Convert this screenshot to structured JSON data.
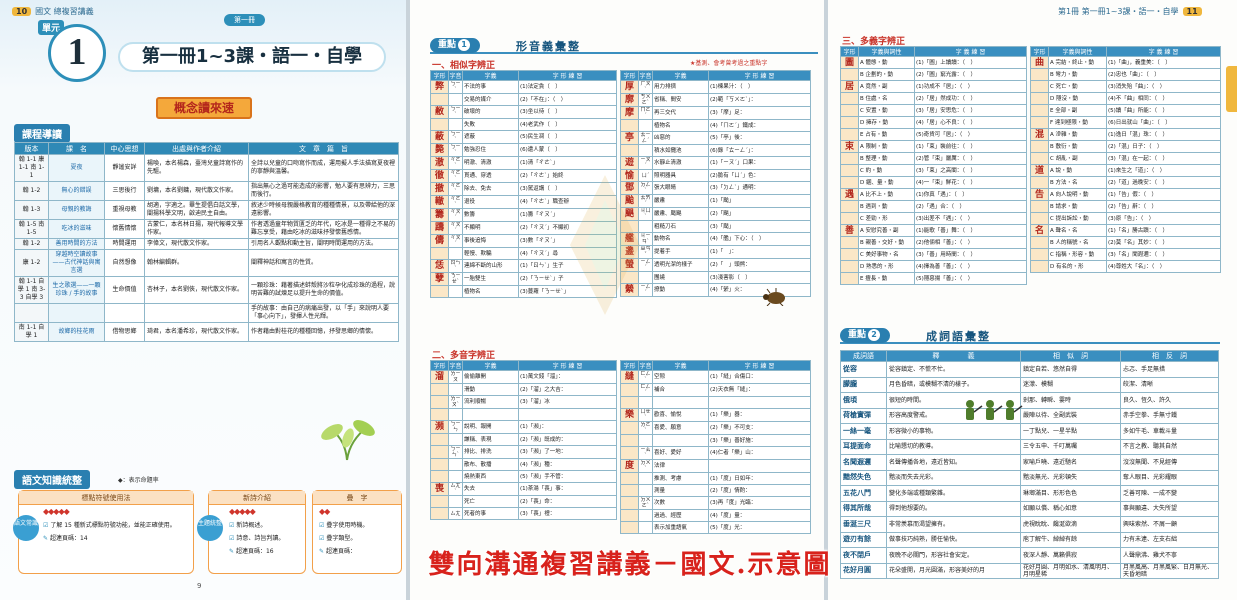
{
  "left": {
    "unit_tag": "單元",
    "unit_number": "1",
    "book_tag": "第一冊",
    "title": "第一冊1~3課・語一・自學",
    "concept_banner": "概念讀來速",
    "course_heading": "課程導讀",
    "course_columns": [
      "版本",
      "課　名",
      "中心思想",
      "出處與作者介紹",
      "文　章　篇　旨"
    ],
    "course_rows": [
      {
        "ver": "翰 1-1 康 1-1 南 1-1",
        "lesson": "夏夜",
        "idea": "靜謐安詳",
        "source": "楊喚，本名楊森，臺灣兒童詩寫作的先驅。",
        "gist": "全詩以兒童的口吻寫作而成，運用擬人手法描寫夏夜裡的寧靜與溫馨。"
      },
      {
        "ver": "翰 1-2",
        "lesson": "無心的錯誤",
        "idea": "三思後行",
        "source": "劉墉，本名劉鏞，現代散文作家。",
        "gist": "指出無心之過可能造成的影響，勉人要有思辨力，三思而後行。"
      },
      {
        "ver": "翰 1-3",
        "lesson": "母親的教誨",
        "idea": "重視母教",
        "source": "胡適，字適之。畢生提倡白話文學，闡揚科學文明，啟迪民主自由。",
        "gist": "敘述少時候母親嚴格教育的種種情景，以及帶給他的深遠影響。"
      },
      {
        "ver": "翰 1-5 南 1-5",
        "lesson": "吃冰的滋味",
        "idea": "懷舊情懷",
        "source": "古蒙仁，本名林日揚，現代報導文學作家。",
        "gist": "作者透過童年物質匱乏的年代，吃冰是一種得之不易的難忘享受，藉由吃冰的滋味抒發懷舊感情。"
      },
      {
        "ver": "翰 1-2",
        "lesson": "善用時間的方法",
        "idea": "時間運用",
        "source": "李偉文，現代散文作家。",
        "gist": "引用名人觀點和動主旨，闡明時間運用的方法。"
      },
      {
        "ver": "康 1-2",
        "lesson": "穿越時空讀故事——古代神話與寓言選",
        "idea": "自然想像",
        "source": "翰林編輯群。",
        "gist": "闡釋神話和寓言的性質。"
      },
      {
        "ver": "翰 1-1 自學 1 南 3-3 自學 3",
        "lesson": "生之歌選——一顆珍珠 / 手的故事",
        "idea": "生命價值",
        "source": "杏林子，本名劉俠，現代散文作家。",
        "gist": "一顆珍珠：藉著描述蚌殼將沙粒孕化成珍珠的過程，說明苦難的試煉足以提升生命的價值。"
      },
      {
        "ver": "",
        "lesson": "",
        "idea": "",
        "source": "",
        "gist": "手的故事：由自己的病痛出發，以「手」來說明人要「事心向下」，發揮人性光輝。"
      },
      {
        "ver": "南 1-1 自學 1",
        "lesson": "故鄉的桂花雨",
        "idea": "借物思鄉",
        "source": "琦君，本名潘希珍，現代散文作家。",
        "gist": "作者藉由對桂花的種種回憶，抒發思鄉的情懷。"
      }
    ],
    "grammar_heading": "語文知識統整",
    "star_note": "◆：表示命題率",
    "grammar_boxes": [
      {
        "side": "語文常識",
        "title": "標點符號使用法",
        "rate": "◆◆◆◆◆",
        "line1": "了解 15 種新式標點符號功能，並能正確使用。",
        "pages": "超連頁碼：14"
      },
      {
        "side": "主題統整",
        "title": "新詩介紹",
        "rate": "◆◆◆◆◆",
        "line1": "新詩概述。",
        "line2": "詩意、詩旨判讀。",
        "pages": "超連頁碼：16"
      },
      {
        "title": "疊　字",
        "rate": "◆◆",
        "line1": "疊字使用時機。",
        "line2": "疊字類型。",
        "pages": "超連頁碼："
      }
    ],
    "page_number": "9"
  },
  "mid": {
    "page_number": "10",
    "header": "國文 總複習講義",
    "focus_label": "重點",
    "focus_num": "1",
    "focus_title": "形音義彙整",
    "similar_heading": "一、相似字辨正",
    "legend": "★基測、會考曾考過之重點字",
    "table_columns": [
      "字形",
      "字音",
      "字義",
      "字 形 練 習"
    ],
    "similar_left": [
      {
        "char": "弊",
        "read": "ㄅㄧˋ",
        "meaning": "不法的事",
        "practice": "(1)法定貪（　）"
      },
      {
        "char": "",
        "read": "",
        "meaning": "交易的媒介",
        "practice": "(2)「不在」：（　）"
      },
      {
        "char": "敝",
        "read": "ㄅㄧˋ",
        "meaning": "破壞的",
        "practice": "(3)坐以待（　）"
      },
      {
        "char": "",
        "read": "",
        "meaning": "失敗",
        "practice": "(4)老武作（　）"
      },
      {
        "char": "蔽",
        "read": "ㄅㄧˋ",
        "meaning": "遮蔽",
        "practice": "(5)民生凋（　）"
      },
      {
        "char": "斃",
        "read": "ㄅㄧˋ",
        "meaning": "勉強忍住",
        "practice": "(6)遭人蒙（　）"
      },
      {
        "char": "澈",
        "read": "ㄔㄜˋ",
        "meaning": "明澈、清澈",
        "practice": "(1)清「ㄔㄜˋ」"
      },
      {
        "char": "徹",
        "read": "ㄔㄜˋ",
        "meaning": "貫通、穿透",
        "practice": "(2)「ㄔㄜˋ」始終"
      },
      {
        "char": "撤",
        "read": "ㄔㄜˋ",
        "meaning": "除去、免去",
        "practice": "(3)駕返講（　）"
      },
      {
        "char": "轍",
        "read": "ㄔㄜˋ",
        "meaning": "退役",
        "practice": "(4)「ㄔㄜˋ」職查辦"
      },
      {
        "char": "籌",
        "read": "ㄔㄡˊ",
        "meaning": "數籌",
        "practice": "(1)籌「ㄔㄡˊ」"
      },
      {
        "char": "躊",
        "read": "ㄔㄡˊ",
        "meaning": "不顯明",
        "practice": "(2)「ㄔㄡˊ」不顯初"
      },
      {
        "char": "儔",
        "read": "ㄔㄡˊ",
        "meaning": "事後追悔",
        "practice": "(3)數「ㄔㄡˊ」"
      },
      {
        "char": "",
        "read": "",
        "meaning": "輕慢、欺騙",
        "practice": "(4)「ㄔㄡˊ」尋"
      },
      {
        "char": "恁",
        "read": "ㄖㄣˋ",
        "meaning": "連綿不斷的山形",
        "practice": "(1)「ㄖㄣˋ」生子"
      },
      {
        "char": "孽",
        "read": "ㄋㄧㄝˋ",
        "meaning": "一胎雙生",
        "practice": "(2)「ㄋㄧㄝˋ」子"
      },
      {
        "char": "",
        "read": "",
        "meaning": "植物名",
        "practice": "(3)蔓蘿「ㄋㄧㄝˋ」"
      }
    ],
    "similar_right": [
      {
        "char": "厚",
        "read": "ㄏㄡˋ",
        "meaning": "用力排擠",
        "practice": "(1)楝果汁：（　）"
      },
      {
        "char": "廓",
        "read": "ㄎㄨㄛˋ",
        "meaning": "省稱、間安",
        "practice": "(2)範「ㄎㄨㄛˋ」："
      },
      {
        "char": "摩",
        "read": "ㄇㄛˊ",
        "meaning": "再三交代",
        "practice": "(3)「摩」足："
      },
      {
        "char": "",
        "read": "",
        "meaning": "植物名",
        "practice": "(4)「ㄇㄛˊ」鐵成："
      },
      {
        "char": "亭",
        "read": "ㄊㄧㄥˊ",
        "meaning": "凶惡的",
        "practice": "(5)「亭」後："
      },
      {
        "char": "",
        "read": "",
        "meaning": "積水如攤池",
        "practice": "(6)錄「ㄊㄧㄥˊ」："
      },
      {
        "char": "遊",
        "read": "ㄧㄡˊ",
        "meaning": "水靜止清澈",
        "practice": "(1)「ㄧㄡˊ」口果："
      },
      {
        "char": "愉",
        "read": "ㄩˊ",
        "meaning": "照明器具",
        "practice": "(2)臉有「ㄩˊ」色："
      },
      {
        "char": "鄧",
        "read": "ㄉㄥˋ",
        "meaning": "張大眼睛",
        "practice": "(3)「ㄉㄥˋ」通明："
      },
      {
        "char": "颱",
        "read": "ㄊㄞˊ",
        "meaning": "嚴肅",
        "practice": "(1)「颱」"
      },
      {
        "char": "颶",
        "read": "ㄐㄩˋ",
        "meaning": "嚴肅、颳颶",
        "practice": "(2)「颶」"
      },
      {
        "char": "",
        "read": "",
        "meaning": "粗糙刀石",
        "practice": "(3)「颳」"
      },
      {
        "char": "艦",
        "read": "ㄐㄧㄢˋ",
        "meaning": "動物名",
        "practice": "(4)「艦」下心：（　）"
      },
      {
        "char": "盞",
        "read": "ㄓㄢˇ",
        "meaning": "提着手",
        "practice": "(1)「　」："
      },
      {
        "char": "螢",
        "read": "ㄧㄥˊ",
        "meaning": "透明光潔的樣子",
        "practice": "(2)「　」頭熊："
      },
      {
        "char": "",
        "read": "",
        "meaning": "團繞",
        "practice": "(3)淺害影（　）"
      },
      {
        "char": "縈",
        "read": "ㄧㄥˊ",
        "meaning": "撩動",
        "practice": "(4)「縈」火："
      }
    ],
    "polyphone_heading": "二、多音字辨正",
    "poly_left": [
      {
        "char": "溜",
        "read": "ㄌㄧㄡ",
        "meaning": "偷偷離開",
        "practice": "(1)萬文錢「溜」："
      },
      {
        "char": "",
        "read": "",
        "meaning": "滑動",
        "practice": "(2)「溜」之大吉："
      },
      {
        "char": "",
        "read": "ㄌㄧㄡˋ",
        "meaning": "流利順暢",
        "practice": "(3)「溜」冰"
      },
      {
        "char": "",
        "read": "",
        "meaning": "",
        "practice": ""
      },
      {
        "char": "瀕",
        "read": "ㄅㄧㄣ",
        "meaning": "說明、報開",
        "practice": "(1)「瀕」："
      },
      {
        "char": "",
        "read": "",
        "meaning": "謙稱、表現",
        "practice": "(2)「瀕」既成的："
      },
      {
        "char": "",
        "read": "ㄅㄧㄣˋ",
        "meaning": "排比、排洗",
        "practice": "(3)「瀕」了一地："
      },
      {
        "char": "",
        "read": "",
        "meaning": "散布、散播",
        "practice": "(4)「瀕」種："
      },
      {
        "char": "",
        "read": "",
        "meaning": "燒熱東西",
        "practice": "(5)「瀕」手不管："
      },
      {
        "char": "喪",
        "read": "ㄙㄤˋ",
        "meaning": "失去",
        "practice": "(1)茶湯「喪」事："
      },
      {
        "char": "",
        "read": "",
        "meaning": "死亡",
        "practice": "(2)「喪」命："
      },
      {
        "char": "",
        "read": "ㄙㄤ",
        "meaning": "死者的事",
        "practice": "(3)「喪」禮："
      }
    ],
    "poly_right": [
      {
        "char": "縫",
        "read": "ㄈㄥˋ",
        "meaning": "空隙",
        "practice": "(1)「縫」合傷口："
      },
      {
        "char": "",
        "read": "ㄈㄥˊ",
        "meaning": "補合",
        "practice": "(2)天衣無「縫」："
      },
      {
        "char": "",
        "read": "",
        "meaning": "",
        "practice": ""
      },
      {
        "char": "樂",
        "read": "ㄩㄝˋ",
        "meaning": "歡喜、愉悅",
        "practice": "(1)「樂」器："
      },
      {
        "char": "",
        "read": "ㄌㄜˋ",
        "meaning": "喜愛、願意",
        "practice": "(2)「樂」不可支："
      },
      {
        "char": "",
        "read": "",
        "meaning": "",
        "practice": "(3)「樂」善好施："
      },
      {
        "char": "",
        "read": "ㄧㄠˋ",
        "meaning": "喜好、愛好",
        "practice": "(4)仁者「樂」山："
      },
      {
        "char": "度",
        "read": "ㄉㄨˋ",
        "meaning": "法律",
        "practice": ""
      },
      {
        "char": "",
        "read": "",
        "meaning": "推測、考慮",
        "practice": "(1)「度」日如年："
      },
      {
        "char": "",
        "read": "",
        "meaning": "測量",
        "practice": "(2)「度」情酌："
      },
      {
        "char": "",
        "read": "ㄉㄨㄛˋ",
        "meaning": "次數",
        "practice": "(3)再「度」光臨："
      },
      {
        "char": "",
        "read": "",
        "meaning": "過過、經歷",
        "practice": "(4)「度」量："
      },
      {
        "char": "",
        "read": "",
        "meaning": "表示加重語氣",
        "practice": "(5)「度」光："
      }
    ]
  },
  "right": {
    "header_unit": "第1冊",
    "header_title": "第一冊1~3課・語一・自學",
    "page_number": "11",
    "multi_heading": "三、多義字辨正",
    "multi_columns": [
      "字形",
      "字義與詞性",
      "字 義 練 習"
    ],
    "multi_left": [
      {
        "char": "圖",
        "meaning": "A 體態・動",
        "practice": "(1)「圖」上讀讀：（　）"
      },
      {
        "char": "",
        "meaning": "B 企劃的・動",
        "practice": "(2)「圖」窮光露：（　）"
      },
      {
        "char": "居",
        "meaning": "A 竟然・副",
        "practice": "(1)功成不「居」：（　）"
      },
      {
        "char": "",
        "meaning": "B 住處・名",
        "practice": "(2)「居」然成功：（　）"
      },
      {
        "char": "",
        "meaning": "C 安置・動",
        "practice": "(3)「居」安思危：（　）"
      },
      {
        "char": "",
        "meaning": "D 擁存・動",
        "practice": "(4)「居」心不良：（　）"
      },
      {
        "char": "",
        "meaning": "E 占有・動",
        "practice": "(5)奇貨可「居」：（　）"
      },
      {
        "char": "束",
        "meaning": "A 限制・動",
        "practice": "(1)「束」裝前往：（　）"
      },
      {
        "char": "",
        "meaning": "B 整理・動",
        "practice": "(2)管「束」嚴厲：（　）"
      },
      {
        "char": "",
        "meaning": "C 約・動",
        "practice": "(3)「束」之高閣：（　）"
      },
      {
        "char": "",
        "meaning": "D 綑、量・動",
        "practice": "(4)一「束」鮮花：（　）"
      },
      {
        "char": "遇",
        "meaning": "A 比不上・動",
        "practice": "(1)你真「遇」：（　）"
      },
      {
        "char": "",
        "meaning": "B 遇到・動",
        "practice": "(2)「遇」合：（　）"
      },
      {
        "char": "",
        "meaning": "C 差勁・形",
        "practice": "(3)出差不「遇」：（　）"
      },
      {
        "char": "善",
        "meaning": "A 安慰究善・副",
        "practice": "(1)能歌「善」舞：（　）"
      },
      {
        "char": "",
        "meaning": "B 親善・交好・動",
        "practice": "(2)他倆相「善」：（　）"
      },
      {
        "char": "",
        "meaning": "C 美好事物・名",
        "practice": "(3)「善」用時間：（　）"
      },
      {
        "char": "",
        "meaning": "D 熟悉的・形",
        "practice": "(4)擇為善「善」：（　）"
      },
      {
        "char": "",
        "meaning": "E 擅長・動",
        "practice": "(5)隱惡揚「善」：（　）"
      }
    ],
    "multi_right": [
      {
        "char": "曲",
        "meaning": "A 完結・終止・動",
        "practice": "(1)「曲」，義重美：（　）"
      },
      {
        "char": "",
        "meaning": "B 彎力・動",
        "practice": "(2)忠也「曲」：（　）"
      },
      {
        "char": "",
        "meaning": "C 死亡・動",
        "practice": "(3)消失殆「曲」：（　）"
      },
      {
        "char": "",
        "meaning": "D 隱沒・動",
        "practice": "(4)不「曲」相同：（　）"
      },
      {
        "char": "",
        "meaning": "E 全部・副",
        "practice": "(5)讀「曲」所能：（　）"
      },
      {
        "char": "",
        "meaning": "F 達到極限・動",
        "practice": "(6)日出就山「曲」：（　）"
      },
      {
        "char": "混",
        "meaning": "A 滲雜・動",
        "practice": "(1)逸日「混」珠：（　）"
      },
      {
        "char": "",
        "meaning": "B 敷衍・動",
        "practice": "(2)「混」日子：（　）"
      },
      {
        "char": "",
        "meaning": "C 胡亂・副",
        "practice": "(3)「混」在一起：（　）"
      },
      {
        "char": "道",
        "meaning": "A 說・動",
        "practice": "(1)來生之「道」：（　）"
      },
      {
        "char": "",
        "meaning": "B 方法・名",
        "practice": "(2)「道」過晚安：（　）"
      },
      {
        "char": "告",
        "meaning": "A 向人說明・動",
        "practice": "(1)「告」假：（　）"
      },
      {
        "char": "",
        "meaning": "B 請求・動",
        "practice": "(2)「告」辭：（　）"
      },
      {
        "char": "",
        "meaning": "C 提出訴訟・動",
        "practice": "(3)原「告」：（　）"
      },
      {
        "char": "名",
        "meaning": "A 聲名・名",
        "practice": "(1)「名」勝古蹟：（　）"
      },
      {
        "char": "",
        "meaning": "B 人的稱號・名",
        "practice": "(2)莫「名」其妙：（　）"
      },
      {
        "char": "",
        "meaning": "C 指稱・形容・動",
        "practice": "(3)「名」聞遐邇：（　）"
      },
      {
        "char": "",
        "meaning": "D 有名的・形",
        "practice": "(4)尊姓大「名」：（　）"
      }
    ],
    "focus_label": "重點",
    "focus_num": "2",
    "focus_title": "成詞語彙整",
    "idiom_columns": [
      "成詞語",
      "釋　　　　義",
      "相　似　詞",
      "相　反　詞"
    ],
    "idioms": [
      {
        "word": "從容",
        "meaning": "從容鎮定、不慌不忙。",
        "similar": "鎮定自若、悠然自得",
        "opposite": "忐忑、手足無措"
      },
      {
        "word": "朦朧",
        "meaning": "月色昏暗，或模糊不清的樣子。",
        "similar": "迷濛、模糊",
        "opposite": "皎潔、清晰"
      },
      {
        "word": "俄頃",
        "meaning": "很短的時間。",
        "similar": "剎那、轉瞬、霎時",
        "opposite": "良久、恆久、許久"
      },
      {
        "word": "荷槍實彈",
        "meaning": "形容高度警戒。",
        "similar": "嚴陣以待、全副武裝",
        "opposite": "赤手空拳、手無寸鐵"
      },
      {
        "word": "一絲一毫",
        "meaning": "形容微小的事物。",
        "similar": "一丁點兒、一星半點",
        "opposite": "多如牛毛、車載斗量"
      },
      {
        "word": "耳提面命",
        "meaning": "比喻懇切的教導。",
        "similar": "三令五申、千叮萬囑",
        "opposite": "不言之教、聽其自然"
      },
      {
        "word": "名聞遐邇",
        "meaning": "名聲傳播各地，遠近皆知。",
        "similar": "家喻戶曉、遠近馳名",
        "opposite": "沒沒無聞、不見經傳"
      },
      {
        "word": "黯然失色",
        "meaning": "黯淡而失去光彩。",
        "similar": "黯淡無光、光彩頓失",
        "opposite": "奪人眼目、光彩耀眼"
      },
      {
        "word": "五花八門",
        "meaning": "變化多端或種類繁雜。",
        "similar": "琳瑯滿目、形形色色",
        "opposite": "乏善可陳、一成不變"
      },
      {
        "word": "得其所哉",
        "meaning": "得到他想要的。",
        "similar": "如願以償、稱心如意",
        "opposite": "事與願違、大失所望"
      },
      {
        "word": "垂涎三尺",
        "meaning": "非常羨慕而渴望擁有。",
        "similar": "虎視眈眈、饞涎欲滴",
        "opposite": "興味索然、不屑一顧"
      },
      {
        "word": "遊刃有餘",
        "meaning": "做事技巧純熟，勝任愉快。",
        "similar": "庖丁解牛、綽綽有餘",
        "opposite": "力有未逮、左支右絀"
      },
      {
        "word": "夜不閉戶",
        "meaning": "夜晚不必關門，形容社會安定。",
        "similar": "夜深人靜、萬籟俱寂",
        "opposite": "人聲鼎沸、雞犬不寧"
      },
      {
        "word": "花好月圓",
        "meaning": "花朵盛開，月光圓滿，形容美好的月",
        "similar": "花好月圓、月明如水、清風明月、月明星稀",
        "opposite": "月黑風高、月黑風緊、日月無光、天昏地暗"
      }
    ]
  },
  "caption": "雙向溝通複習講義－國文.示意圖",
  "colors": {
    "accent": "#2a7fb0",
    "highlight": "#d0431d",
    "caption": "#d8221c",
    "banner": "#f4a83b"
  }
}
